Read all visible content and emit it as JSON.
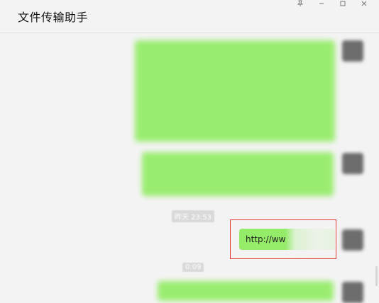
{
  "window": {
    "title": "文件传输助手",
    "controls": {
      "pin_icon": "pin-icon",
      "minimize_icon": "minimize-icon",
      "maximize_icon": "maximize-icon",
      "close_icon": "close-icon"
    }
  },
  "chat": {
    "timestamps": [
      "昨天 23:53",
      "0:09"
    ],
    "messages": [
      {
        "type": "blurred_text",
        "sender": "self"
      },
      {
        "type": "blurred_text",
        "sender": "self"
      },
      {
        "type": "link",
        "sender": "self",
        "text": "http://ww"
      },
      {
        "type": "blurred_text",
        "sender": "self"
      }
    ]
  },
  "colors": {
    "bubble_green": "#95ec69",
    "highlight_red": "#e53935",
    "background": "#f3f3f3"
  }
}
